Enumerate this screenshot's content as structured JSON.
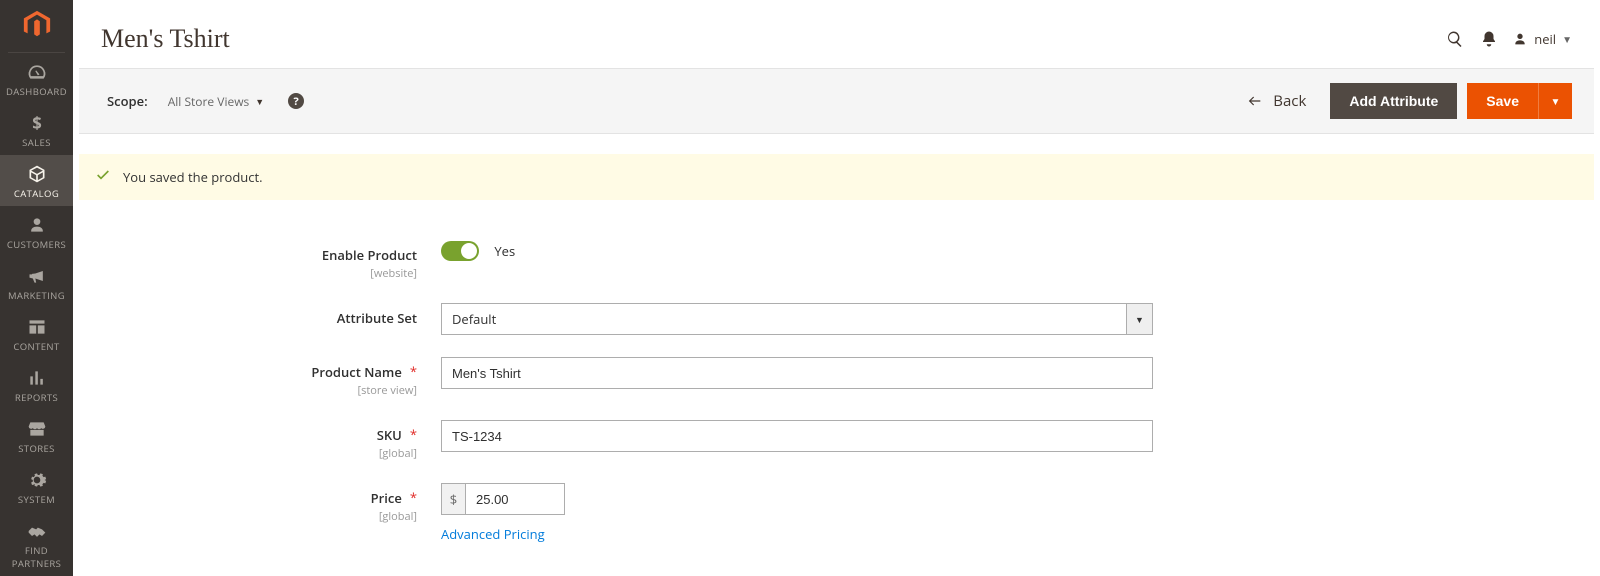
{
  "sidebar": {
    "items": [
      {
        "id": "dashboard",
        "label": "DASHBOARD"
      },
      {
        "id": "sales",
        "label": "SALES"
      },
      {
        "id": "catalog",
        "label": "CATALOG",
        "active": true
      },
      {
        "id": "customers",
        "label": "CUSTOMERS"
      },
      {
        "id": "marketing",
        "label": "MARKETING"
      },
      {
        "id": "content",
        "label": "CONTENT"
      },
      {
        "id": "reports",
        "label": "REPORTS"
      },
      {
        "id": "stores",
        "label": "STORES"
      },
      {
        "id": "system",
        "label": "SYSTEM"
      },
      {
        "id": "find-partners",
        "label": "FIND PARTNERS"
      }
    ]
  },
  "header": {
    "page_title": "Men's Tshirt",
    "user_name": "neil"
  },
  "actionbar": {
    "scope_label": "Scope:",
    "scope_value": "All Store Views",
    "back_label": "Back",
    "add_attribute_label": "Add Attribute",
    "save_label": "Save"
  },
  "message": {
    "text": "You saved the product."
  },
  "form": {
    "enable_product": {
      "label": "Enable Product",
      "scope": "[website]",
      "value_label": "Yes",
      "value": true
    },
    "attribute_set": {
      "label": "Attribute Set",
      "value": "Default"
    },
    "product_name": {
      "label": "Product Name",
      "scope": "[store view]",
      "value": "Men's Tshirt"
    },
    "sku": {
      "label": "SKU",
      "scope": "[global]",
      "value": "TS-1234"
    },
    "price": {
      "label": "Price",
      "scope": "[global]",
      "currency": "$",
      "value": "25.00",
      "advanced_link": "Advanced Pricing"
    }
  }
}
